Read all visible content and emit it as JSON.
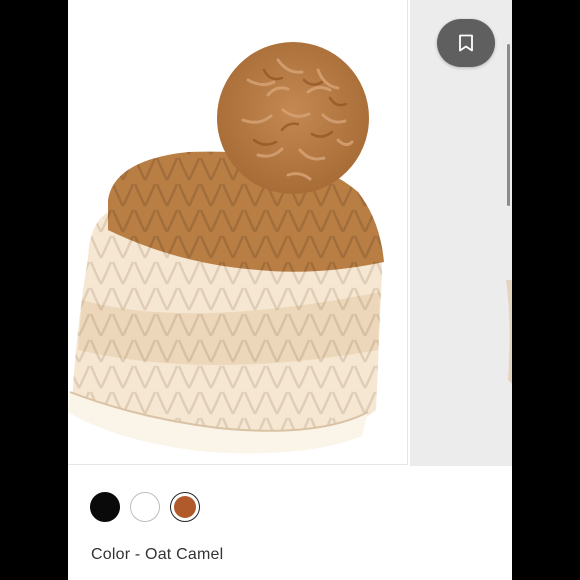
{
  "product": {
    "image_alt": "Chunky knit pom beanie",
    "bookmark_icon": "bookmark-icon",
    "color_label": "Color - Oat Camel",
    "swatches": [
      {
        "name": "black",
        "color": "#0a0a0a",
        "selected": false
      },
      {
        "name": "white",
        "color": "#ffffff",
        "selected": false
      },
      {
        "name": "camel",
        "color": "#b0592a",
        "selected": true
      }
    ]
  },
  "colors": {
    "camel": "#b0763e",
    "oat": "#efd9bd",
    "cream": "#faf3e6",
    "overlay_button": "#5f5f5f"
  }
}
